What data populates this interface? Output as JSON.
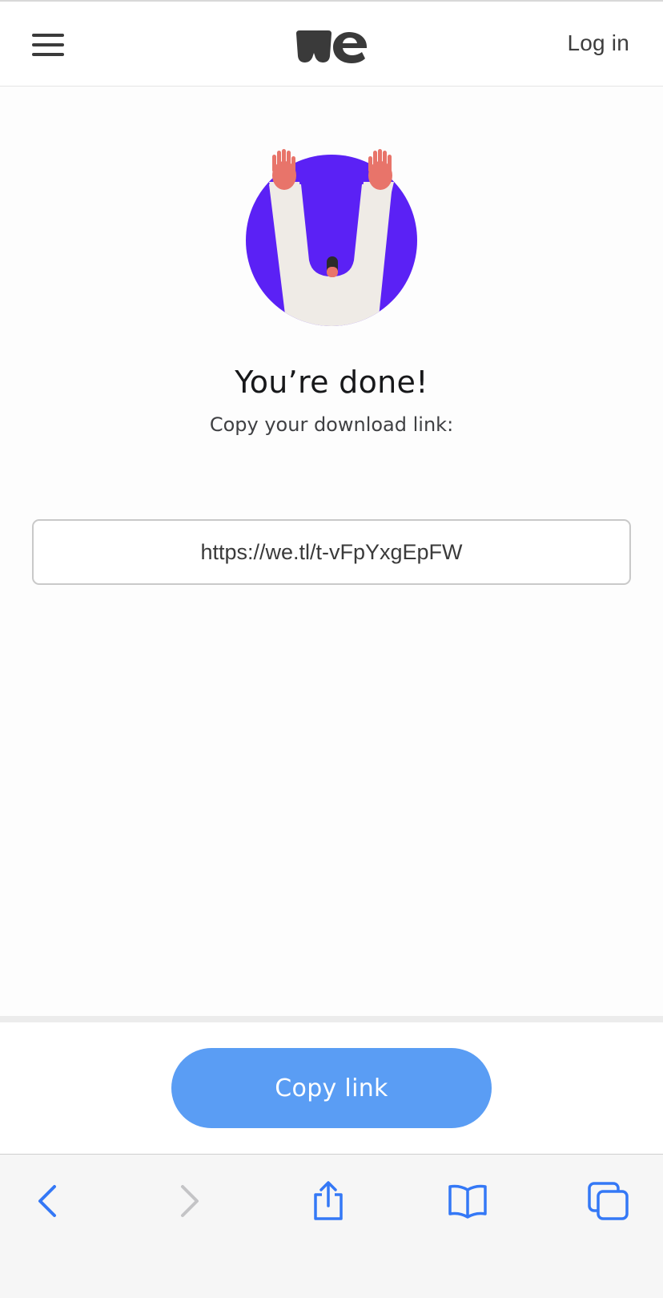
{
  "header": {
    "menu_icon": "hamburger-menu-icon",
    "logo_icon": "wetransfer-logo",
    "login_label": "Log in"
  },
  "main": {
    "illustration_icon": "celebration-raised-arms-illustration",
    "title": "You’re done!",
    "subtitle": "Copy your download link:",
    "download_link": "https://we.tl/t-vFpYxgEpFW"
  },
  "action": {
    "copy_label": "Copy link"
  },
  "browser_toolbar": {
    "back_icon": "chevron-left-icon",
    "forward_icon": "chevron-right-icon",
    "share_icon": "share-icon",
    "bookmarks_icon": "book-icon",
    "tabs_icon": "tabs-icon"
  },
  "colors": {
    "accent": "#5a9df4",
    "illustration_circle": "#5b21f5",
    "skin": "#e8746a",
    "sleeve": "#efebe6",
    "safari_blue": "#3478f6",
    "disabled_gray": "#c4c4c6"
  }
}
